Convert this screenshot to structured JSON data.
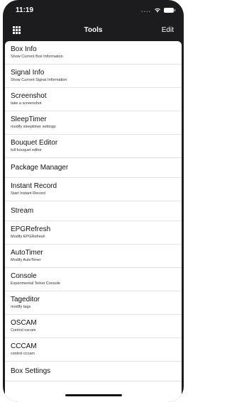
{
  "status_bar": {
    "time": "11:19",
    "signal_dots": "....",
    "icons": [
      "wifi-icon",
      "battery-icon"
    ]
  },
  "navbar": {
    "menu_icon": "grid-icon",
    "title": "Tools",
    "edit_label": "Edit"
  },
  "tools": [
    {
      "title": "Box Info",
      "subtitle": "Show Current Box Information"
    },
    {
      "title": "Signal Info",
      "subtitle": "Show Current Signal Information"
    },
    {
      "title": "Screenshot",
      "subtitle": "take a screenshot"
    },
    {
      "title": "SleepTimer",
      "subtitle": "modify sleeptimer settings"
    },
    {
      "title": "Bouquet Editor",
      "subtitle": "full bouquet editor"
    },
    {
      "title": "Package Manager",
      "subtitle": ""
    },
    {
      "title": "Instant Record",
      "subtitle": "Start Instant Record"
    },
    {
      "title": "Stream",
      "subtitle": ""
    },
    {
      "title": "EPGRefresh",
      "subtitle": "Modify EPGRefresh"
    },
    {
      "title": "AutoTimer",
      "subtitle": "Modify AutoTimer"
    },
    {
      "title": "Console",
      "subtitle": "Experimental Telnet Console"
    },
    {
      "title": "Tageditor",
      "subtitle": "modify tags"
    },
    {
      "title": "OSCAM",
      "subtitle": "Control oscam"
    },
    {
      "title": "CCCAM",
      "subtitle": "control cccam"
    },
    {
      "title": "Box Settings",
      "subtitle": ""
    }
  ],
  "colors": {
    "header_bg": "#1c1c1e",
    "list_bg": "#ffffff",
    "separator": "#e3e3e6"
  }
}
